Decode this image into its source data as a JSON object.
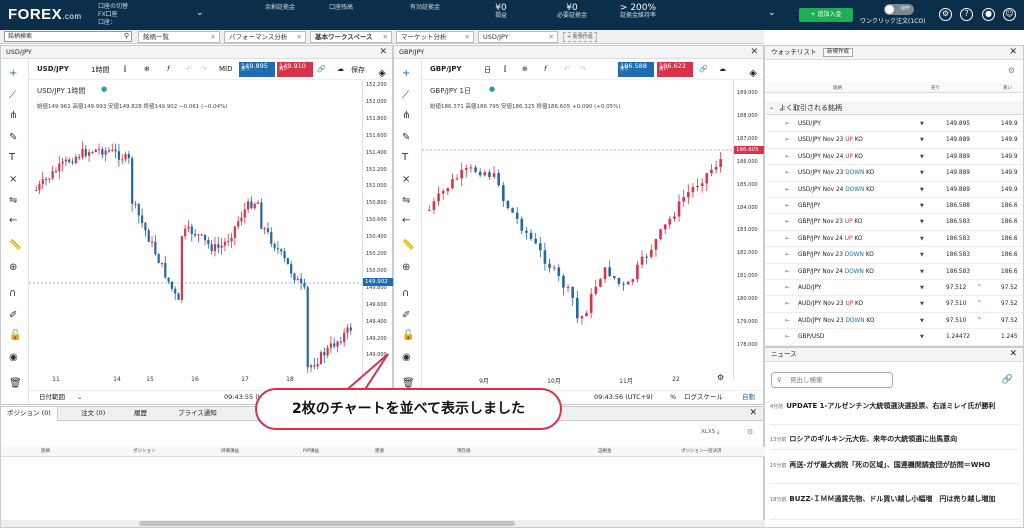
{
  "header": {
    "logo": "FOREX",
    "logo_suffix": ".com",
    "account_lines": [
      "口座の切替",
      "FX口座",
      "口座："
    ],
    "stats": [
      {
        "label": "余剰証拠金",
        "value": ""
      },
      {
        "label": "口座残高",
        "value": ""
      },
      {
        "label": "有効証拠金",
        "value": ""
      },
      {
        "label": "損益",
        "value": "¥0"
      },
      {
        "label": "必要証拠金",
        "value": "¥0"
      },
      {
        "label": "証拠金維持率",
        "value": "> 200%"
      }
    ],
    "add_funds": "+ 追加入金",
    "one_click": "ワンクリック注文(1CO)",
    "toggle": "OFF"
  },
  "subbar": {
    "search": "銘柄検索",
    "tabs": [
      "銘柄一覧",
      "パフォーマンス分析",
      "基本ワークスペース",
      "マーケット分析",
      "USD/JPY"
    ],
    "new_tab": "+ 新規作成"
  },
  "left_chart": {
    "tab": "USD/JPY",
    "symbol": "USD/JPY",
    "interval": "1時間",
    "mid": "MID",
    "sell_label": "売り",
    "sell": "149.895",
    "buy_label": "買い",
    "buy": "149.910",
    "save": "保存",
    "title": "USD/JPY  1時間",
    "ohlc": "始値149.961 高値149.993 安値149.828 終値149.902 −0.061 (−0.04%)",
    "y_ticks": [
      "152.200",
      "152.000",
      "151.800",
      "151.600",
      "151.400",
      "151.200",
      "151.000",
      "150.800",
      "150.600",
      "150.400",
      "150.200",
      "150.000",
      "149.800",
      "149.600",
      "149.400",
      "149.200",
      "149.000"
    ],
    "price_tag": "149.902",
    "x_ticks": [
      "11",
      "14",
      "15",
      "16",
      "17",
      "18"
    ],
    "time": "09:43:55 (UTC+9)",
    "range": "日付範囲"
  },
  "right_chart": {
    "tab": "GBP/JPY",
    "symbol": "GBP/JPY",
    "interval": "日",
    "sell_label": "売り",
    "sell": "186.588",
    "buy_label": "買い",
    "buy": "186.622",
    "title": "GBP/JPY  1日",
    "ohlc": "始値186.371 高値186.795 安値186.325 終値186.605 +0.090 (+0.05%)",
    "y_ticks": [
      "189.000",
      "188.000",
      "187.000",
      "186.000",
      "185.000",
      "184.000",
      "183.000",
      "182.000",
      "181.000",
      "180.000",
      "179.000",
      "178.000"
    ],
    "price_tag": "186.605",
    "x_ticks": [
      "9月",
      "10月",
      "11月",
      "22"
    ],
    "time": "09:43:56 (UTC+9)",
    "pct": "%",
    "log": "ログスケール",
    "auto": "自動"
  },
  "watchlist": {
    "title": "ウォッチリスト",
    "new_btn": "新規作成",
    "col_symbol": "銘柄",
    "col_sell": "売り",
    "col_buy": "買い",
    "group": "よく取引される銘柄",
    "rows": [
      {
        "pre": "USD/JPY",
        "mid": "",
        "post": "",
        "dir": "",
        "sell": "149.895",
        "buy": "149.9"
      },
      {
        "pre": "USD/JPY Nov 23 ",
        "mid": "UP",
        "post": " KO",
        "dir": "up",
        "sell": "149.889",
        "buy": "149.9"
      },
      {
        "pre": "USD/JPY Nov 24 ",
        "mid": "UP",
        "post": " KO",
        "dir": "up",
        "sell": "149.889",
        "buy": "149.9"
      },
      {
        "pre": "USD/JPY Nov 23 ",
        "mid": "DOWN",
        "post": " KO",
        "dir": "dn",
        "sell": "149.889",
        "buy": "149.9"
      },
      {
        "pre": "USD/JPY Nov 24 ",
        "mid": "DOWN",
        "post": " KO",
        "dir": "dn",
        "sell": "149.889",
        "buy": "149.9"
      },
      {
        "pre": "GBP/JPY",
        "mid": "",
        "post": "",
        "dir": "",
        "sell": "186.588",
        "buy": "186.6"
      },
      {
        "pre": "GBP/JPY Nov 23 ",
        "mid": "UP",
        "post": " KO",
        "dir": "up",
        "sell": "186.583",
        "buy": "186.6"
      },
      {
        "pre": "GBP/JPY Nov 24 ",
        "mid": "UP",
        "post": " KO",
        "dir": "up",
        "sell": "186.583",
        "buy": "186.6"
      },
      {
        "pre": "GBP/JPY Nov 23 ",
        "mid": "DOWN",
        "post": " KO",
        "dir": "dn",
        "sell": "186.583",
        "buy": "186.6"
      },
      {
        "pre": "GBP/JPY Nov 24 ",
        "mid": "DOWN",
        "post": " KO",
        "dir": "dn",
        "sell": "186.583",
        "buy": "186.6"
      },
      {
        "pre": "AUD/JPY",
        "mid": "",
        "post": "",
        "dir": "",
        "sell": "97.512",
        "buy": "97.52",
        "arrow": "^"
      },
      {
        "pre": "AUD/JPY Nov 23 ",
        "mid": "UP",
        "post": " KO",
        "dir": "up",
        "sell": "97.510",
        "buy": "97.52",
        "arrow": "^"
      },
      {
        "pre": "AUD/JPY Nov 23 ",
        "mid": "DOWN",
        "post": " KO",
        "dir": "dn",
        "sell": "97.510",
        "buy": "97.52",
        "arrow": "^"
      },
      {
        "pre": "GBP/USD",
        "mid": "",
        "post": "",
        "dir": "",
        "sell": "1.24472",
        "buy": "1.245"
      }
    ]
  },
  "news": {
    "title": "ニュース",
    "search": "見出し検索",
    "items": [
      {
        "t": "4分前",
        "h": "UPDATE 1-アルゼンチン大統領選決選投票、右派ミレイ氏が勝利"
      },
      {
        "t": "13分前",
        "h": "ロシアのギルキン元大佐、来年の大統領選に出馬意向"
      },
      {
        "t": "15分前",
        "h": "再送-ガザ最大病院「死の区域」、国連機関調査団が訪問＝WHO"
      },
      {
        "t": "18分前",
        "h": "BUZZ-ＩＭＭ通貨先物、ドル買い越し小幅増　円は売り越し増加"
      }
    ]
  },
  "positions": {
    "tabs": [
      "ポジション (0)",
      "注文 (0)",
      "履歴",
      "プライス通知"
    ],
    "export": "XLXS",
    "columns": [
      "銘柄",
      "ポジション",
      "評価損益",
      "P/P損益",
      "建値",
      "現在値",
      "",
      "証拠金",
      "ポジション一括決済"
    ]
  },
  "callout": "2枚のチャートを並べて表示しました"
}
